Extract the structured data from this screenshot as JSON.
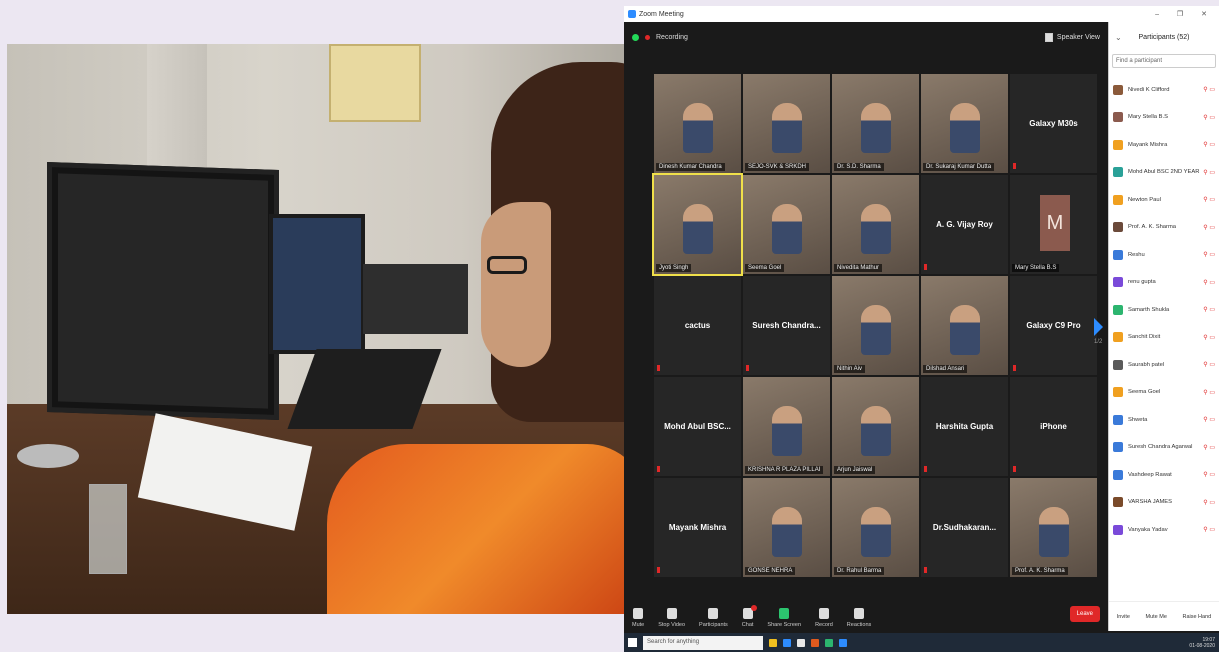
{
  "window": {
    "title": "Zoom Meeting",
    "controls": "– ❐ ✕"
  },
  "topbar": {
    "recording": "Recording",
    "view": "Speaker View"
  },
  "tiles": [
    {
      "type": "video",
      "label": "Dinesh Kumar Chandra",
      "active": false
    },
    {
      "type": "video",
      "label": "SEJO-SVK & SRKDH",
      "active": false
    },
    {
      "type": "video",
      "label": "Dr. S.D. Sharma",
      "active": false
    },
    {
      "type": "video",
      "label": "Dr. Sukaraj Kumar Dutta",
      "active": false
    },
    {
      "type": "name",
      "name": "Galaxy M30s",
      "label": "",
      "active": false
    },
    {
      "type": "video",
      "label": "Jyoti Singh",
      "active": true
    },
    {
      "type": "video",
      "label": "Seema Goel",
      "active": false
    },
    {
      "type": "video",
      "label": "Nivedita Mathur",
      "active": false
    },
    {
      "type": "name",
      "name": "A. G. Vijay Roy",
      "label": "",
      "active": false
    },
    {
      "type": "avatar",
      "letter": "M",
      "label": "Mary Stella B.S",
      "active": false
    },
    {
      "type": "name",
      "name": "cactus",
      "label": "",
      "active": false
    },
    {
      "type": "name",
      "name": "Suresh Chandra...",
      "label": "",
      "active": false
    },
    {
      "type": "video",
      "label": "Nithin Aiv",
      "active": false
    },
    {
      "type": "video",
      "label": "Dilshad Ansari",
      "active": false
    },
    {
      "type": "name",
      "name": "Galaxy C9 Pro",
      "label": "",
      "active": false
    },
    {
      "type": "name",
      "name": "Mohd Abul BSC...",
      "label": "",
      "active": false
    },
    {
      "type": "video",
      "label": "KRISHNA R PLAZA PILLAI",
      "active": false
    },
    {
      "type": "video",
      "label": "Arjun Jaiswal",
      "active": false
    },
    {
      "type": "name",
      "name": "Harshita Gupta",
      "label": "",
      "active": false
    },
    {
      "type": "name",
      "name": "iPhone",
      "label": "",
      "active": false
    },
    {
      "type": "name",
      "name": "Mayank Mishra",
      "label": "",
      "active": false
    },
    {
      "type": "video",
      "label": "GONSE NEHRA",
      "active": false
    },
    {
      "type": "video",
      "label": "Dr. Rahul Barma",
      "active": false
    },
    {
      "type": "name",
      "name": "Dr.Sudhakaran...",
      "label": "",
      "active": false
    },
    {
      "type": "video",
      "label": "Prof. A. K. Sharma",
      "active": false
    }
  ],
  "page_arrow": {
    "text": "1/2"
  },
  "toolbar": {
    "items": [
      {
        "label": "Mute",
        "icon": "mic-icon"
      },
      {
        "label": "Stop Video",
        "icon": "video-camera-icon"
      },
      {
        "label": "Participants",
        "icon": "participants-icon",
        "count": "52"
      },
      {
        "label": "Chat",
        "icon": "chat-icon"
      },
      {
        "label": "Share Screen",
        "icon": "share-screen-icon"
      },
      {
        "label": "Record",
        "icon": "record-icon"
      },
      {
        "label": "Reactions",
        "icon": "reactions-icon"
      }
    ],
    "leave": "Leave"
  },
  "panel": {
    "title": "Participants (52)",
    "search_placeholder": "Find a participant",
    "participants": [
      {
        "name": "Nivedi K Clifford",
        "color": "#8b5a3a"
      },
      {
        "name": "Mary Stella B.S",
        "color": "#8b5a4e"
      },
      {
        "name": "Mayank Mishra",
        "color": "#f0a020"
      },
      {
        "name": "Mohd Abul BSC 2ND YEAR",
        "color": "#2aa198"
      },
      {
        "name": "Newton Paul",
        "color": "#f0a020"
      },
      {
        "name": "Prof. A. K. Sharma",
        "color": "#6b4a3a"
      },
      {
        "name": "Reshu",
        "color": "#3a7ad9"
      },
      {
        "name": "renu gupta",
        "color": "#7a4ad9"
      },
      {
        "name": "Samarth Shukla",
        "color": "#2cb56f"
      },
      {
        "name": "Sanchit Dixit",
        "color": "#f0a020"
      },
      {
        "name": "Saurabh patel",
        "color": "#5a5a5a"
      },
      {
        "name": "Seema Goel",
        "color": "#f0a020"
      },
      {
        "name": "Shweta",
        "color": "#3a7ad9"
      },
      {
        "name": "Suresh Chandra Agarwal",
        "color": "#3a7ad9"
      },
      {
        "name": "Vashdeep Rawat",
        "color": "#3a7ad9"
      },
      {
        "name": "VARSHA JAMES",
        "color": "#7a4a2a"
      },
      {
        "name": "Vanyaka Yadav",
        "color": "#7a4ad9"
      }
    ],
    "footer": [
      "Invite",
      "Mute Me",
      "Raise Hand"
    ]
  },
  "taskbar": {
    "search": "Search for anything",
    "time": "19:07",
    "date": "01-08-2020"
  }
}
